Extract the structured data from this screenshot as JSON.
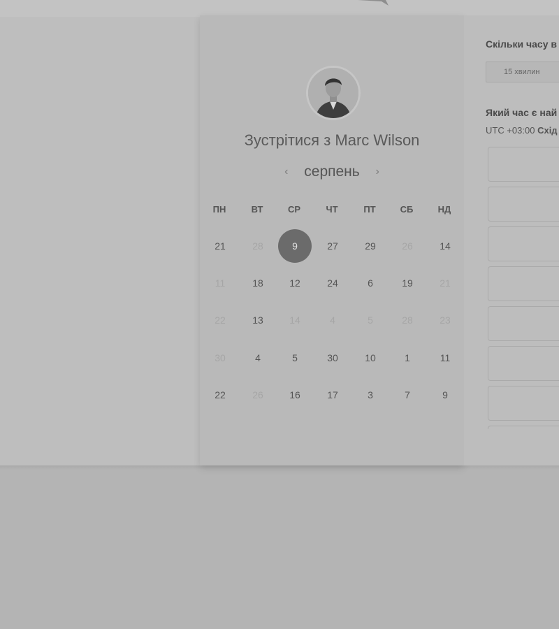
{
  "calendar": {
    "title": "Зустрітися з Marc Wilson",
    "month": "серпень",
    "prev_icon": "chevron-left-icon",
    "next_icon": "chevron-right-icon",
    "weekdays": [
      "ПН",
      "ВТ",
      "СР",
      "ЧТ",
      "ПТ",
      "СБ",
      "НД"
    ],
    "weeks": [
      [
        {
          "d": "21",
          "s": "avail"
        },
        {
          "d": "28",
          "s": "disabled"
        },
        {
          "d": "9",
          "s": "selected"
        },
        {
          "d": "27",
          "s": "avail"
        },
        {
          "d": "29",
          "s": "avail"
        },
        {
          "d": "26",
          "s": "disabled"
        },
        {
          "d": "14",
          "s": "avail"
        }
      ],
      [
        {
          "d": "11",
          "s": "disabled"
        },
        {
          "d": "18",
          "s": "avail"
        },
        {
          "d": "12",
          "s": "avail"
        },
        {
          "d": "24",
          "s": "avail"
        },
        {
          "d": "6",
          "s": "avail"
        },
        {
          "d": "19",
          "s": "avail"
        },
        {
          "d": "21",
          "s": "disabled"
        }
      ],
      [
        {
          "d": "22",
          "s": "disabled"
        },
        {
          "d": "13",
          "s": "avail"
        },
        {
          "d": "14",
          "s": "disabled"
        },
        {
          "d": "4",
          "s": "disabled"
        },
        {
          "d": "5",
          "s": "disabled"
        },
        {
          "d": "28",
          "s": "disabled"
        },
        {
          "d": "23",
          "s": "disabled"
        }
      ],
      [
        {
          "d": "30",
          "s": "disabled"
        },
        {
          "d": "4",
          "s": "avail"
        },
        {
          "d": "5",
          "s": "avail"
        },
        {
          "d": "30",
          "s": "avail"
        },
        {
          "d": "10",
          "s": "avail"
        },
        {
          "d": "1",
          "s": "avail"
        },
        {
          "d": "11",
          "s": "avail"
        }
      ],
      [
        {
          "d": "22",
          "s": "avail"
        },
        {
          "d": "26",
          "s": "disabled"
        },
        {
          "d": "16",
          "s": "avail"
        },
        {
          "d": "17",
          "s": "avail"
        },
        {
          "d": "3",
          "s": "avail"
        },
        {
          "d": "7",
          "s": "avail"
        },
        {
          "d": "9",
          "s": "avail"
        }
      ]
    ]
  },
  "booking": {
    "duration_question": "Скільки часу в",
    "duration_option": "15 хвилин",
    "time_question": "Який час є най",
    "timezone_prefix": "UTC +03:00",
    "timezone_name": "Схід",
    "slot_count": 8
  },
  "colors": {
    "selected_day": "#6b6b6b",
    "background": "#b4b4b4"
  }
}
